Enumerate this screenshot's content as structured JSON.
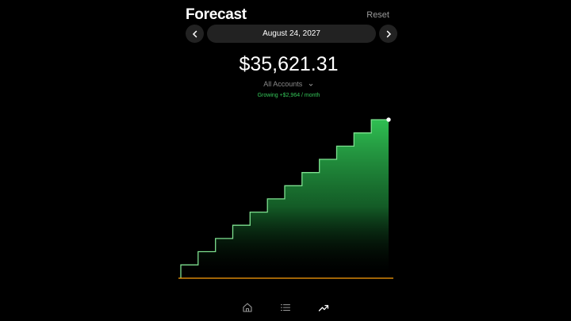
{
  "header": {
    "title": "Forecast",
    "reset_label": "Reset"
  },
  "date_nav": {
    "date": "August 24, 2027",
    "prev_icon": "chevron-left-icon",
    "next_icon": "chevron-right-icon"
  },
  "summary": {
    "amount": "$35,621.31",
    "account_filter": "All Accounts",
    "growth": "Growing +$2,964 / month"
  },
  "colors": {
    "accent_green": "#34c759",
    "baseline_orange": "#ff9f0a",
    "pill_bg": "#222222",
    "muted": "#8a8a8a"
  },
  "chart_data": {
    "type": "area",
    "step": true,
    "values": [
      3000,
      5964,
      8928,
      11892,
      14856,
      17820,
      20784,
      23748,
      26712,
      29676,
      32640,
      35621.31
    ],
    "grid": false
  },
  "tabbar": {
    "items": [
      {
        "icon": "home-icon",
        "active": false
      },
      {
        "icon": "list-icon",
        "active": false
      },
      {
        "icon": "trend-up-icon",
        "active": true
      }
    ]
  }
}
